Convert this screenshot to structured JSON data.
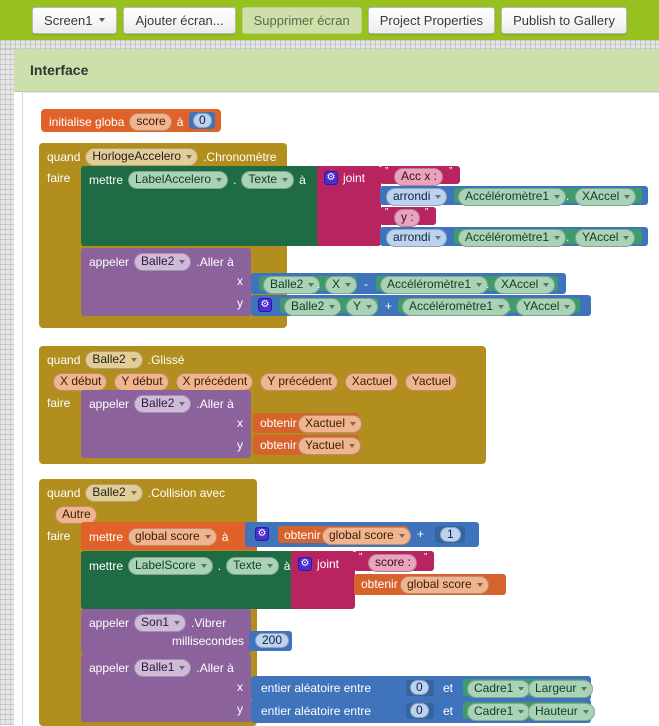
{
  "toolbar": {
    "screen_selector": "Screen1",
    "add_screen": "Ajouter écran...",
    "remove_screen": "Supprimer écran",
    "project_properties": "Project Properties",
    "publish_gallery": "Publish to Gallery"
  },
  "panel": {
    "title": "Interface"
  },
  "colors": {
    "toolbar_green": "#96c11e",
    "panel_green": "#cddfab",
    "event_gold": "#b18e1e",
    "setter_green": "#1e6b44",
    "call_purple": "#8b629c",
    "math_blue": "#3f74bd",
    "text_magenta": "#b8245f",
    "variable_orange": "#e0622a",
    "component_green": "#3f9b6b"
  },
  "blocks": {
    "init_global": {
      "keyword": "initialise globa",
      "name": "score",
      "to": "à",
      "value": "0"
    },
    "event1": {
      "when": "quand",
      "component": "HorlogeAccelero",
      "event": ".Chronomètre",
      "do": "faire",
      "set_row": {
        "set": "mettre",
        "component": "LabelAccelero",
        "dot": ".",
        "property": "Texte",
        "to": "à"
      },
      "join": {
        "label": "joint",
        "items": [
          {
            "type": "text",
            "value": "Acc x :"
          },
          {
            "type": "round",
            "label": "arrondi",
            "component": "Accéléromètre1",
            "property": "XAccel"
          },
          {
            "type": "text",
            "value": "y :"
          },
          {
            "type": "round",
            "label": "arrondi",
            "component": "Accéléromètre1",
            "property": "YAccel"
          }
        ]
      },
      "move_call": {
        "call": "appeler",
        "component": "Balle2",
        "method": ".Aller à",
        "x_label": "x",
        "y_label": "y",
        "x_expr": {
          "left_component": "Balle2",
          "left_property": "X",
          "operator": "-",
          "right_component": "Accéléromètre1",
          "right_property": "XAccel"
        },
        "y_expr": {
          "left_component": "Balle2",
          "left_property": "Y",
          "operator": "+",
          "right_component": "Accéléromètre1",
          "right_property": "YAccel"
        }
      }
    },
    "event2": {
      "when": "quand",
      "component": "Balle2",
      "event": ".Glissé",
      "params": [
        "X début",
        "Y début",
        "X précédent",
        "Y précédent",
        "Xactuel",
        "Yactuel"
      ],
      "do": "faire",
      "move_call": {
        "call": "appeler",
        "component": "Balle2",
        "method": ".Aller à",
        "x_label": "x",
        "y_label": "y",
        "x_get": {
          "get": "obtenir",
          "var": "Xactuel"
        },
        "y_get": {
          "get": "obtenir",
          "var": "Yactuel"
        }
      }
    },
    "event3": {
      "when": "quand",
      "component": "Balle2",
      "event": ".Collision avec",
      "param": "Autre",
      "do": "faire",
      "set_score": {
        "set": "mettre",
        "var": "global score",
        "to": "à",
        "get": "obtenir",
        "get_var": "global score",
        "operator": "+",
        "addend": "1"
      },
      "set_label": {
        "set": "mettre",
        "component": "LabelScore",
        "dot": ".",
        "property": "Texte",
        "to": "à",
        "join_label": "joint",
        "text_value": "score :",
        "get": "obtenir",
        "get_var": "global score"
      },
      "vibrate": {
        "call": "appeler",
        "component": "Son1",
        "method": ".Vibrer",
        "arg_label": "millisecondes",
        "arg_value": "200"
      },
      "move_ball1": {
        "call": "appeler",
        "component": "Balle1",
        "method": ".Aller à",
        "x_label": "x",
        "y_label": "y",
        "x_rand": {
          "label": "entier aléatoire entre",
          "from": "0",
          "and": "et",
          "component": "Cadre1",
          "property": "Largeur"
        },
        "y_rand": {
          "label": "entier aléatoire entre",
          "from": "0",
          "and": "et",
          "component": "Cadre1",
          "property": "Hauteur"
        }
      }
    }
  }
}
